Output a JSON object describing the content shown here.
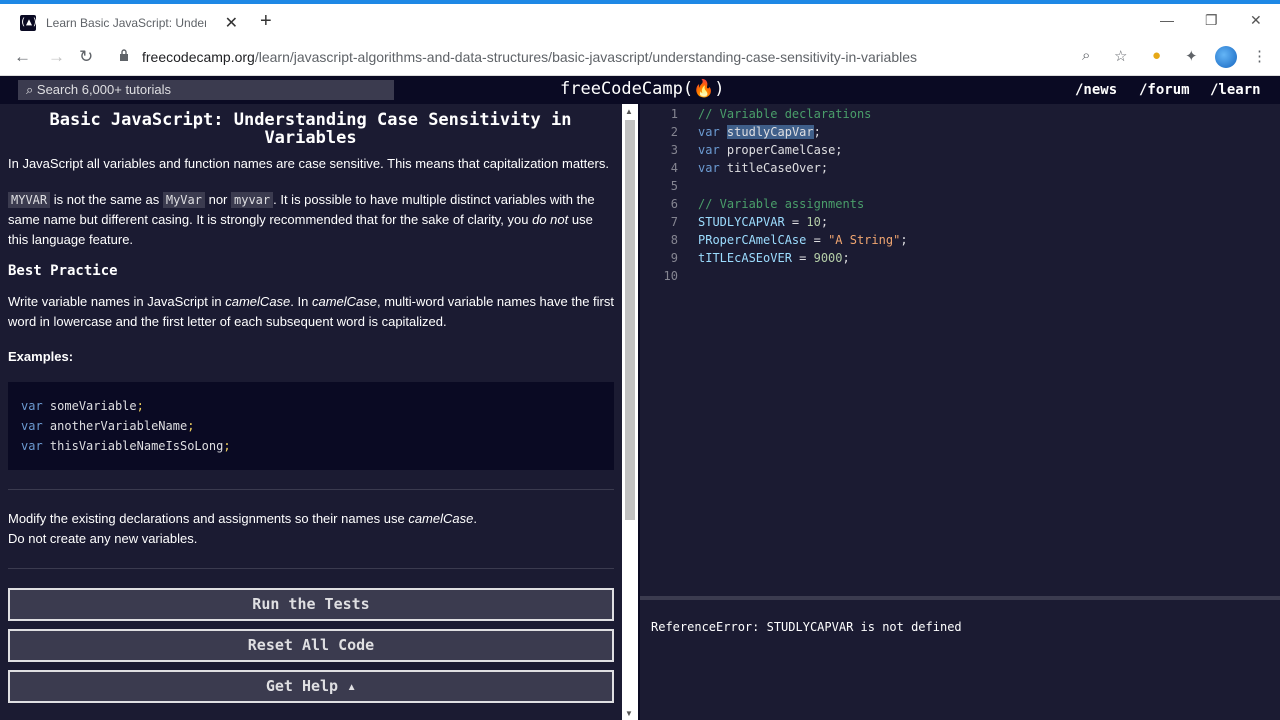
{
  "browser": {
    "tab_title": "Learn Basic JavaScript: Understa",
    "url_host": "freecodecamp.org",
    "url_path": "/learn/javascript-algorithms-and-data-structures/basic-javascript/understanding-case-sensitivity-in-variables"
  },
  "nav": {
    "search_placeholder": "Search 6,000+ tutorials",
    "logo": "freeCodeCamp(🔥)",
    "links": [
      "/news",
      "/forum",
      "/learn"
    ]
  },
  "lesson": {
    "title": "Basic JavaScript: Understanding Case Sensitivity in Variables",
    "p1": "In JavaScript all variables and function names are case sensitive. This means that capitalization matters.",
    "p2_code1": "MYVAR",
    "p2_t1": " is not the same as ",
    "p2_code2": "MyVar",
    "p2_t2": " nor ",
    "p2_code3": "myvar",
    "p2_t3": ". It is possible to have multiple distinct variables with the same name but different casing. It is strongly recommended that for the sake of clarity, you ",
    "p2_em": "do not",
    "p2_t4": " use this language feature.",
    "best_heading": "Best Practice",
    "p3_t1": "Write variable names in JavaScript in ",
    "p3_em1": "camelCase",
    "p3_t2": ". In ",
    "p3_em2": "camelCase",
    "p3_t3": ", multi-word variable names have the first word in lowercase and the first letter of each subsequent word is capitalized.",
    "examples_label": "Examples:",
    "examples": [
      {
        "kw": "var",
        "name": "someVariable",
        "semi": ";"
      },
      {
        "kw": "var",
        "name": "anotherVariableName",
        "semi": ";"
      },
      {
        "kw": "var",
        "name": "thisVariableNameIsSoLong",
        "semi": ";"
      }
    ],
    "instr_t1": "Modify the existing declarations and assignments so their names use ",
    "instr_em": "camelCase",
    "instr_t2": ".",
    "instr_2": "Do not create any new variables."
  },
  "buttons": {
    "run": "Run the Tests",
    "reset": "Reset All Code",
    "help": "Get Help ▴"
  },
  "editor": {
    "lines": [
      {
        "n": "1",
        "text": "// Variable declarations"
      },
      {
        "n": "2",
        "kw": "var",
        "sel": "studlyCapVar",
        "rest": ";"
      },
      {
        "n": "3",
        "kw": "var",
        "rest": "properCamelCase;"
      },
      {
        "n": "4",
        "kw": "var",
        "rest": "titleCaseOver;"
      },
      {
        "n": "5"
      },
      {
        "n": "6",
        "text": "// Variable assignments"
      },
      {
        "n": "7",
        "lhs": "STUDLYCAPVAR",
        "op": " = ",
        "val": "10",
        "end": ";"
      },
      {
        "n": "8",
        "lhs": "PRoperCAmelCAse",
        "op": " = ",
        "val": "\"A String\"",
        "end": ";"
      },
      {
        "n": "9",
        "lhs": "tITLEcASEoVER",
        "op": " = ",
        "val": "9000",
        "end": ";"
      },
      {
        "n": "10"
      }
    ]
  },
  "console": {
    "output": "ReferenceError: STUDLYCAPVAR is not defined"
  }
}
